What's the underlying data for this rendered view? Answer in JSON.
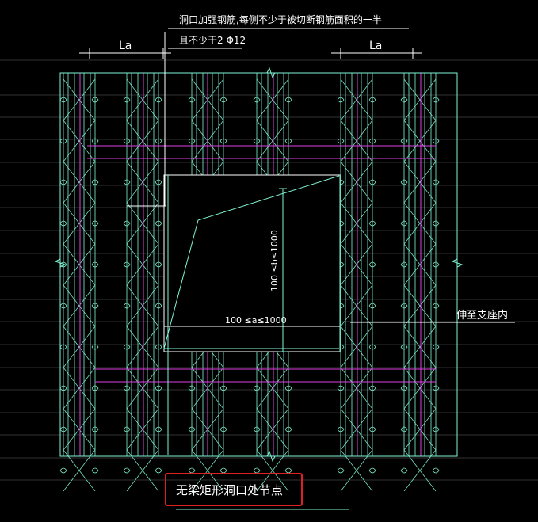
{
  "annotations": {
    "top_note_line1": "洞口加强钢筋,每侧不少于被切断钢筋面积的一半",
    "top_note_line2": "且不少于2 Φ12",
    "la_left": "La",
    "la_right": "La",
    "dim_b": "100 ≤b≤1000",
    "dim_a": "100 ≤a≤1000",
    "extend_note": "伸至支座内",
    "title": "无梁矩形洞口处节点"
  },
  "colors": {
    "background": "#000000",
    "cyan": "#7ff5d4",
    "white": "#ffffff",
    "magenta": "#e040e0",
    "gridline": "#b8b8b8",
    "highlight": "#e02020"
  }
}
